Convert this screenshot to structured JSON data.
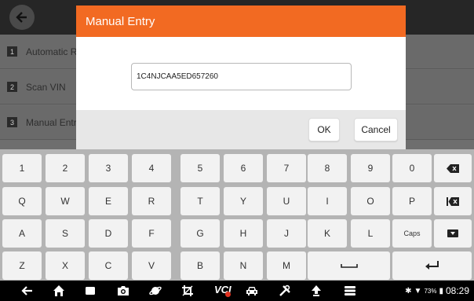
{
  "background": {
    "list": [
      {
        "num": "1",
        "label": "Automatic Re"
      },
      {
        "num": "2",
        "label": "Scan VIN"
      },
      {
        "num": "3",
        "label": "Manual Entry"
      }
    ]
  },
  "dialog": {
    "title": "Manual Entry",
    "vin_value": "1C4NJCAA5ED657260",
    "ok_label": "OK",
    "cancel_label": "Cancel"
  },
  "keyboard": {
    "row1": [
      "1",
      "2",
      "3",
      "4",
      "5",
      "6",
      "7",
      "8",
      "9",
      "0"
    ],
    "row2": [
      "Q",
      "W",
      "E",
      "R",
      "T",
      "Y",
      "U",
      "I",
      "O",
      "P"
    ],
    "row3": [
      "A",
      "S",
      "D",
      "F",
      "G",
      "H",
      "J",
      "K",
      "L"
    ],
    "caps_label": "Caps",
    "row4": [
      "Z",
      "X",
      "C",
      "V",
      "B",
      "N",
      "M"
    ]
  },
  "navbar": {
    "vci_label": "VCI",
    "battery": "73%",
    "time": "08:29"
  },
  "colors": {
    "accent": "#f26a22",
    "vci_dot": "#e0301e"
  }
}
